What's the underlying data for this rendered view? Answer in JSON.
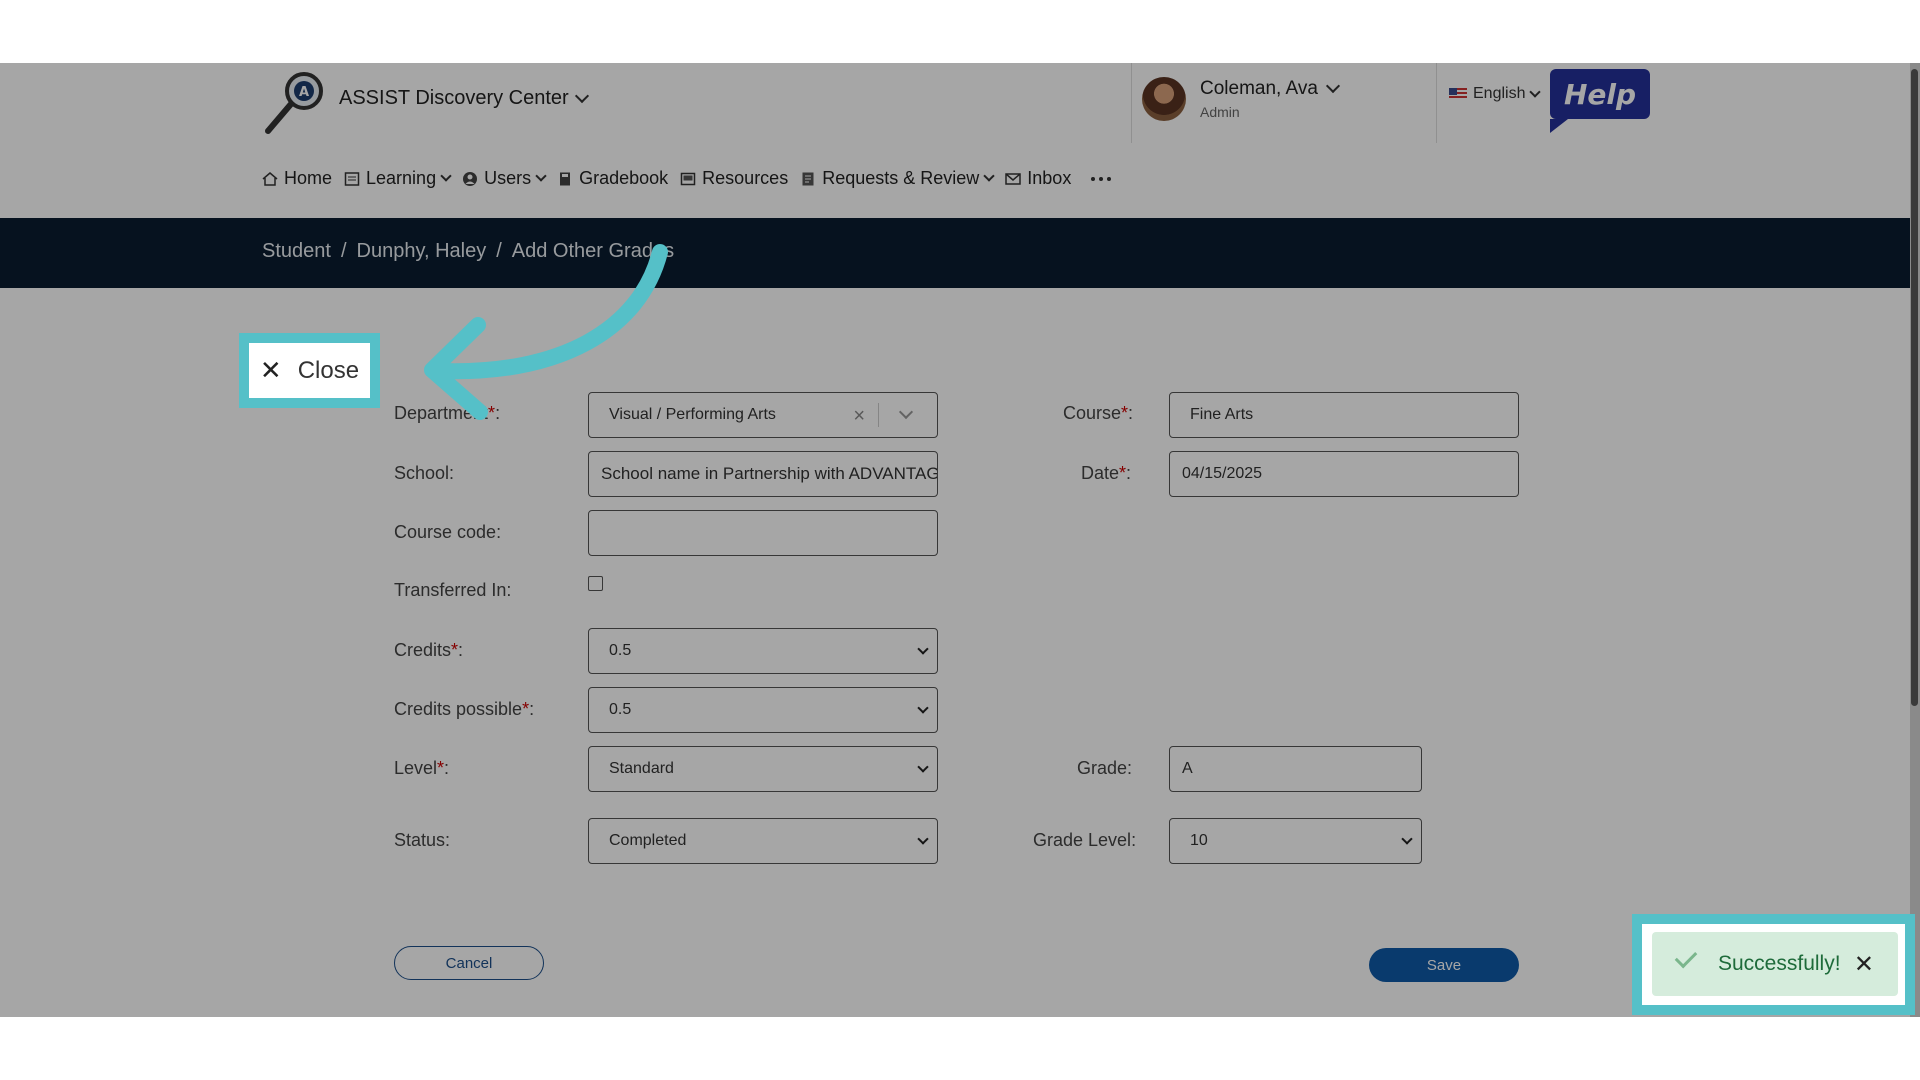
{
  "header": {
    "app_name": "ASSIST Discovery Center",
    "user_name": "Coleman, Ava",
    "user_role": "Admin",
    "language": "English",
    "help_label": "Help"
  },
  "nav": {
    "items": [
      {
        "label": "Home",
        "icon": "home-icon"
      },
      {
        "label": "Learning",
        "icon": "learning-icon",
        "dropdown": true
      },
      {
        "label": "Users",
        "icon": "user-icon",
        "dropdown": true
      },
      {
        "label": "Gradebook",
        "icon": "gradebook-icon"
      },
      {
        "label": "Resources",
        "icon": "resources-icon"
      },
      {
        "label": "Requests & Review",
        "icon": "requests-icon",
        "dropdown": true
      },
      {
        "label": "Inbox",
        "icon": "inbox-icon"
      }
    ]
  },
  "breadcrumb": [
    "Student",
    "/",
    "Dunphy, Haley",
    "/",
    "Add Other Grades"
  ],
  "close_label": "Close",
  "form": {
    "department_label": "Department",
    "department_value": "Visual / Performing Arts",
    "course_label": "Course",
    "course_value": "Fine Arts",
    "school_label": "School",
    "school_value": "School name in Partnership with ADVANTAGES",
    "date_label": "Date",
    "date_value": "04/15/2025",
    "course_code_label": "Course code",
    "course_code_value": "",
    "transferred_label": "Transferred In",
    "transferred_checked": false,
    "credits_label": "Credits",
    "credits_value": "0.5",
    "credits_possible_label": "Credits possible",
    "credits_possible_value": "0.5",
    "level_label": "Level",
    "level_value": "Standard",
    "grade_label": "Grade",
    "grade_value": "A",
    "status_label": "Status",
    "status_value": "Completed",
    "grade_level_label": "Grade Level",
    "grade_level_value": "10",
    "required_mark": "*",
    "colon": ":"
  },
  "buttons": {
    "cancel": "Cancel",
    "save": "Save"
  },
  "toast": {
    "message": "Successfully!"
  },
  "colors": {
    "highlight": "#55c0c8",
    "breadcrumb_bg": "#0a1d30",
    "primary": "#0e5aa8",
    "help_bg": "#24309a",
    "toast_bg": "#d5ecdc"
  }
}
